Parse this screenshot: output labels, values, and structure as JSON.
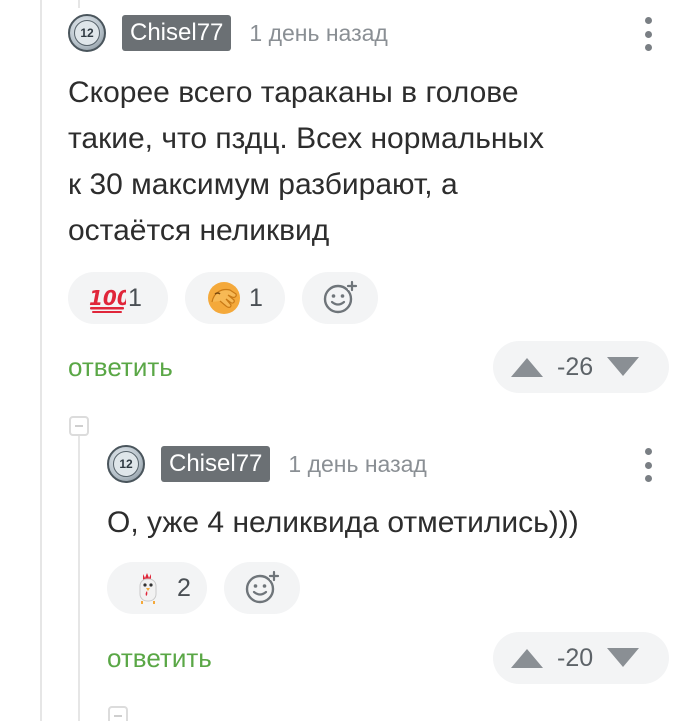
{
  "comments": [
    {
      "avatar_badge": "12",
      "username": "Chisel77",
      "time": "1 день назад",
      "text_lines": [
        "Скорее всего тараканы в голове",
        "такие, что пздц. Всех нормальных",
        "к 30 максимум разбирают, а",
        "остаётся неликвид"
      ],
      "reactions": [
        {
          "icon": "hundred-points-icon",
          "count": "1"
        },
        {
          "icon": "facepalm-icon",
          "count": "1"
        }
      ],
      "reply_label": "ответить",
      "rating": "-26"
    },
    {
      "avatar_badge": "12",
      "username": "Chisel77",
      "time": "1 день назад",
      "text_lines": [
        "О, уже 4 неликвида отметились)))"
      ],
      "reactions": [
        {
          "icon": "chicken-icon",
          "count": "2"
        }
      ],
      "reply_label": "ответить",
      "rating": "-20"
    }
  ],
  "colors": {
    "username_bg": "#6b7074",
    "reply_green": "#5aa746",
    "pill_bg": "#f3f4f5",
    "arrow_gray": "#8a8f94"
  }
}
